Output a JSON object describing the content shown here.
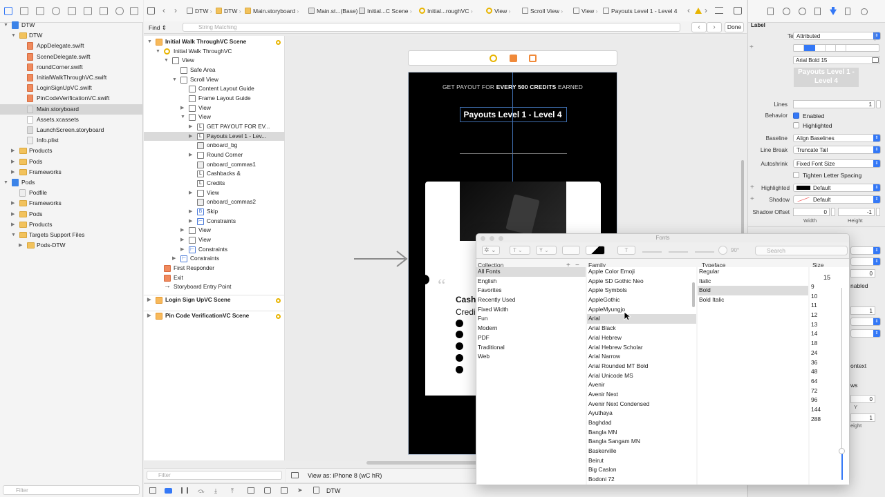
{
  "navigator": {
    "filter_placeholder": "Filter",
    "items": [
      {
        "label": "DTW",
        "kind": "project",
        "indent": 0,
        "disc": "▼"
      },
      {
        "label": "DTW",
        "kind": "folder",
        "indent": 1,
        "disc": "▼"
      },
      {
        "label": "AppDelegate.swift",
        "kind": "swift",
        "indent": 2,
        "disc": ""
      },
      {
        "label": "SceneDelegate.swift",
        "kind": "swift",
        "indent": 2,
        "disc": ""
      },
      {
        "label": "roundCorner.swift",
        "kind": "swift",
        "indent": 2,
        "disc": ""
      },
      {
        "label": "InitialWalkThroughVC.swift",
        "kind": "swift",
        "indent": 2,
        "disc": ""
      },
      {
        "label": "LoginSignUpVC.swift",
        "kind": "swift",
        "indent": 2,
        "disc": ""
      },
      {
        "label": "PinCodeVerificationVC.swift",
        "kind": "swift",
        "indent": 2,
        "disc": ""
      },
      {
        "label": "Main.storyboard",
        "kind": "storyboard",
        "indent": 2,
        "disc": "",
        "selected": true
      },
      {
        "label": "Assets.xcassets",
        "kind": "assets",
        "indent": 2,
        "disc": ""
      },
      {
        "label": "LaunchScreen.storyboard",
        "kind": "storyboard",
        "indent": 2,
        "disc": ""
      },
      {
        "label": "Info.plist",
        "kind": "plist",
        "indent": 2,
        "disc": ""
      },
      {
        "label": "Products",
        "kind": "folder",
        "indent": 1,
        "disc": "▶"
      },
      {
        "label": "Pods",
        "kind": "folder",
        "indent": 1,
        "disc": "▶"
      },
      {
        "label": "Frameworks",
        "kind": "folder",
        "indent": 1,
        "disc": "▶"
      },
      {
        "label": "Pods",
        "kind": "project",
        "indent": 0,
        "disc": "▼"
      },
      {
        "label": "Podfile",
        "kind": "plist",
        "indent": 1,
        "disc": ""
      },
      {
        "label": "Frameworks",
        "kind": "folder",
        "indent": 1,
        "disc": "▶"
      },
      {
        "label": "Pods",
        "kind": "folder",
        "indent": 1,
        "disc": "▶"
      },
      {
        "label": "Products",
        "kind": "folder",
        "indent": 1,
        "disc": "▶"
      },
      {
        "label": "Targets Support Files",
        "kind": "folder",
        "indent": 1,
        "disc": "▼"
      },
      {
        "label": "Pods-DTW",
        "kind": "folder",
        "indent": 2,
        "disc": "▶"
      }
    ]
  },
  "jump_bar": {
    "items": [
      "DTW",
      "DTW",
      "Main.storyboard",
      "Main.st...(Base)",
      "Initial...C Scene",
      "Initial...roughVC",
      "View",
      "Scroll View",
      "View",
      "Payouts Level 1 - Level 4"
    ]
  },
  "find_bar": {
    "label": "Find",
    "placeholder": "String Matching",
    "done": "Done"
  },
  "outline": {
    "rows": [
      {
        "label": "Initial Walk ThroughVC Scene",
        "indent": 0,
        "disc": "▼",
        "icon": "sc",
        "bold": true,
        "dot": true
      },
      {
        "label": "Initial Walk ThroughVC",
        "indent": 1,
        "disc": "▼",
        "icon": "yc"
      },
      {
        "label": "View",
        "indent": 2,
        "disc": "▼",
        "icon": "v"
      },
      {
        "label": "Safe Area",
        "indent": 3,
        "disc": "",
        "icon": "v"
      },
      {
        "label": "Scroll View",
        "indent": 3,
        "disc": "▼",
        "icon": "v"
      },
      {
        "label": "Content Layout Guide",
        "indent": 4,
        "disc": "",
        "icon": "v"
      },
      {
        "label": "Frame Layout Guide",
        "indent": 4,
        "disc": "",
        "icon": "v"
      },
      {
        "label": "View",
        "indent": 4,
        "disc": "▶",
        "icon": "v"
      },
      {
        "label": "View",
        "indent": 4,
        "disc": "▼",
        "icon": "v"
      },
      {
        "label": "GET PAYOUT FOR EV...",
        "indent": 5,
        "disc": "▶",
        "icon": "L"
      },
      {
        "label": "Payouts Level 1 - Lev...",
        "indent": 5,
        "disc": "▶",
        "icon": "L",
        "selected": true
      },
      {
        "label": "onboard_bg",
        "indent": 5,
        "disc": "",
        "icon": "img"
      },
      {
        "label": "Round Corner",
        "indent": 5,
        "disc": "▶",
        "icon": "v"
      },
      {
        "label": "onboard_commas1",
        "indent": 5,
        "disc": "",
        "icon": "img"
      },
      {
        "label": "Cashbacks &",
        "indent": 5,
        "disc": "",
        "icon": "L"
      },
      {
        "label": "Credits",
        "indent": 5,
        "disc": "",
        "icon": "L"
      },
      {
        "label": "View",
        "indent": 5,
        "disc": "▶",
        "icon": "v"
      },
      {
        "label": "onboard_commas2",
        "indent": 5,
        "disc": "",
        "icon": "img"
      },
      {
        "label": "Skip",
        "indent": 5,
        "disc": "▶",
        "icon": "B"
      },
      {
        "label": "Constraints",
        "indent": 5,
        "disc": "▶",
        "icon": "c"
      },
      {
        "label": "View",
        "indent": 4,
        "disc": "▶",
        "icon": "v"
      },
      {
        "label": "View",
        "indent": 4,
        "disc": "▶",
        "icon": "v"
      },
      {
        "label": "Constraints",
        "indent": 4,
        "disc": "▶",
        "icon": "c"
      },
      {
        "label": "Constraints",
        "indent": 3,
        "disc": "▶",
        "icon": "c"
      },
      {
        "label": "First Responder",
        "indent": 1,
        "disc": "",
        "icon": "fr"
      },
      {
        "label": "Exit",
        "indent": 1,
        "disc": "",
        "icon": "ex"
      },
      {
        "label": "Storyboard Entry Point",
        "indent": 1,
        "disc": "",
        "icon": "arrow"
      }
    ],
    "scenes": [
      {
        "label": "Login Sign UpVC Scene"
      },
      {
        "label": "Pin Code VerificationVC Scene"
      }
    ],
    "filter_placeholder": "Filter"
  },
  "device": {
    "headline_prefix": "GET PAYOUT FOR ",
    "headline_bold": "EVERY 500 CREDITS",
    "headline_suffix": " EARNED",
    "title": "Payouts Level 1 - Level 4",
    "card_text_1": "Cash",
    "card_text_2": "Credi",
    "quote": "“"
  },
  "bottom_bar": {
    "view_as": "View as: iPhone 8 (wC hR)",
    "scheme": "DTW"
  },
  "inspector": {
    "section": "Label",
    "text_label": "Text",
    "text_value": "Attributed",
    "font_value": "Arial Bold 15",
    "preview_text": "Payouts Level 1 - Level 4",
    "lines_label": "Lines",
    "lines_value": "1",
    "behavior_label": "Behavior",
    "enabled": "Enabled",
    "highlighted_chk": "Highlighted",
    "baseline_label": "Baseline",
    "baseline_value": "Align Baselines",
    "linebreak_label": "Line Break",
    "linebreak_value": "Truncate Tail",
    "autoshrink_label": "Autoshrink",
    "autoshrink_value": "Fixed Font Size",
    "tighten": "Tighten Letter Spacing",
    "highlighted_label": "Highlighted",
    "highlighted_value": "Default",
    "shadow_label": "Shadow",
    "shadow_value": "Default",
    "shadow_offset_label": "Shadow Offset",
    "offset_w": "0",
    "offset_h": "-1",
    "width": "Width",
    "height": "Height",
    "partial": [
      "ontext",
      "ws",
      "Y",
      "eight",
      "nabled"
    ],
    "partial_vals": [
      "0",
      "1",
      "0",
      "1"
    ]
  },
  "fonts_panel": {
    "title": "Fonts",
    "search_placeholder": "Search",
    "angle": "90°",
    "headers": {
      "collection": "Collection",
      "family": "Family",
      "typeface": "Typeface",
      "size": "Size"
    },
    "size_value": "15",
    "collections": [
      "All Fonts",
      "English",
      "Favorites",
      "Recently Used",
      "Fixed Width",
      "Fun",
      "Modern",
      "PDF",
      "Traditional",
      "Web"
    ],
    "families": [
      "Apple Color Emoji",
      "Apple SD Gothic Neo",
      "Apple Symbols",
      "AppleGothic",
      "AppleMyungjo",
      "Arial",
      "Arial Black",
      "Arial Hebrew",
      "Arial Hebrew Scholar",
      "Arial Narrow",
      "Arial Rounded MT Bold",
      "Arial Unicode MS",
      "Avenir",
      "Avenir Next",
      "Avenir Next Condensed",
      "Ayuthaya",
      "Baghdad",
      "Bangla MN",
      "Bangla Sangam MN",
      "Baskerville",
      "Beirut",
      "Big Caslon",
      "Bodoni 72"
    ],
    "typefaces": [
      "Regular",
      "Italic",
      "Bold",
      "Bold Italic"
    ],
    "sizes": [
      "9",
      "10",
      "11",
      "12",
      "13",
      "14",
      "18",
      "24",
      "36",
      "48",
      "64",
      "72",
      "96",
      "144",
      "288"
    ],
    "selected_family": "Arial",
    "selected_typeface": "Bold",
    "selected_collection": "All Fonts"
  }
}
